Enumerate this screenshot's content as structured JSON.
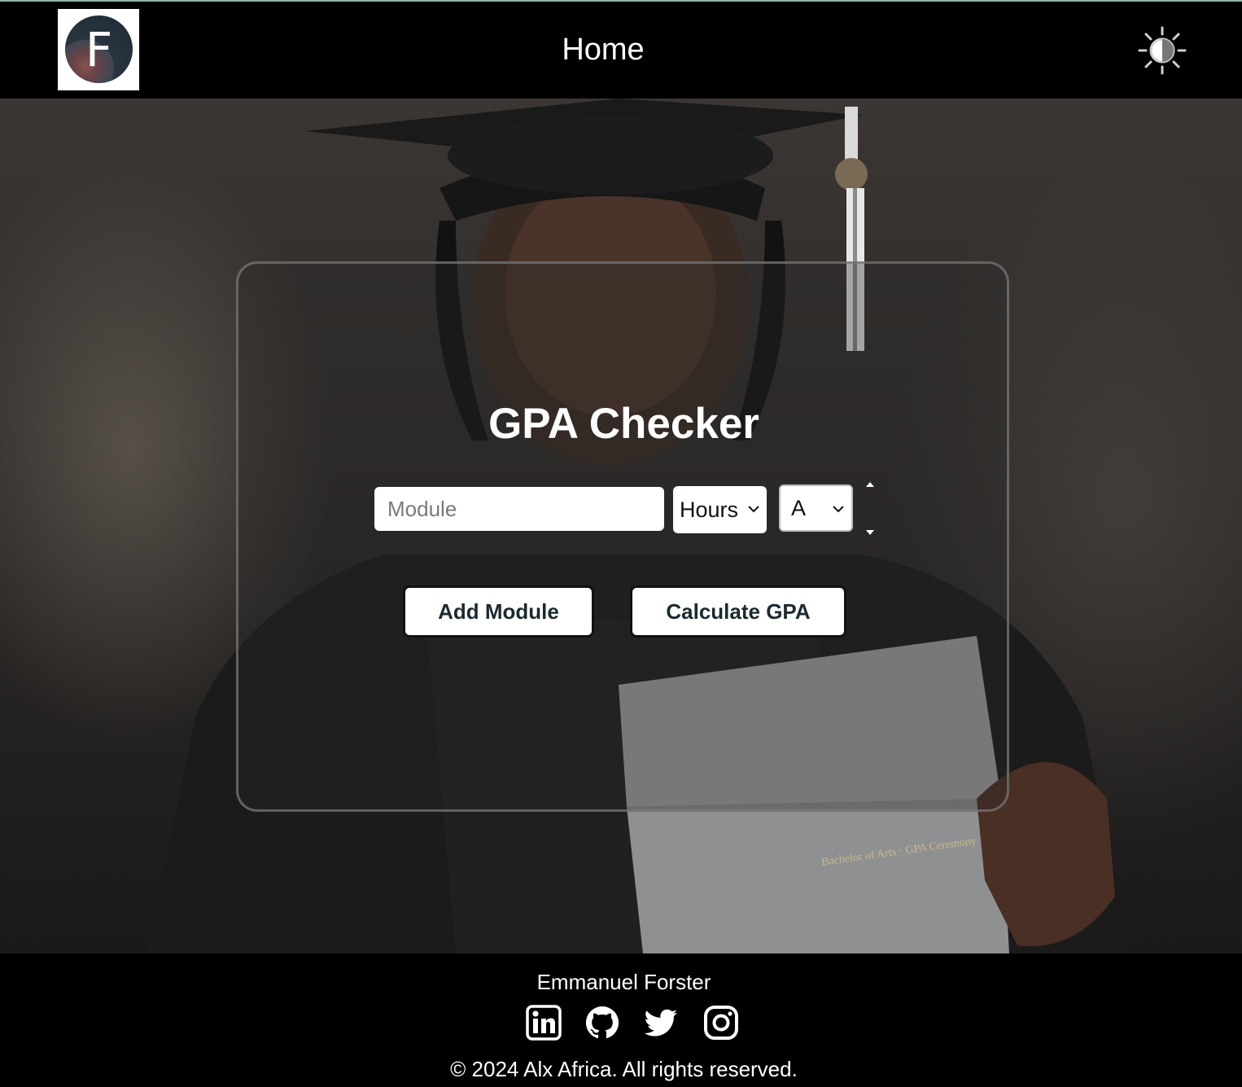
{
  "header": {
    "logo_letter": "F",
    "title": "Home",
    "theme_toggle_icon": "contrast-sun-icon"
  },
  "main": {
    "title": "GPA Checker",
    "module_input": {
      "placeholder": "Module",
      "value": ""
    },
    "hours_select": {
      "selected": "Hours"
    },
    "grade_select": {
      "selected": "A"
    },
    "buttons": {
      "add_module": "Add Module",
      "calculate_gpa": "Calculate GPA"
    },
    "certificate_text": "Bachelor of Arts · GPA Ceremony"
  },
  "footer": {
    "author": "Emmanuel Forster",
    "social_icons": [
      "linkedin-icon",
      "github-icon",
      "twitter-icon",
      "instagram-icon"
    ],
    "copyright": "© 2024 Alx Africa. All rights reserved."
  },
  "colors": {
    "header_bg": "#000000",
    "footer_bg": "#000000",
    "button_text": "#1c2a30",
    "card_border": "#787878"
  }
}
